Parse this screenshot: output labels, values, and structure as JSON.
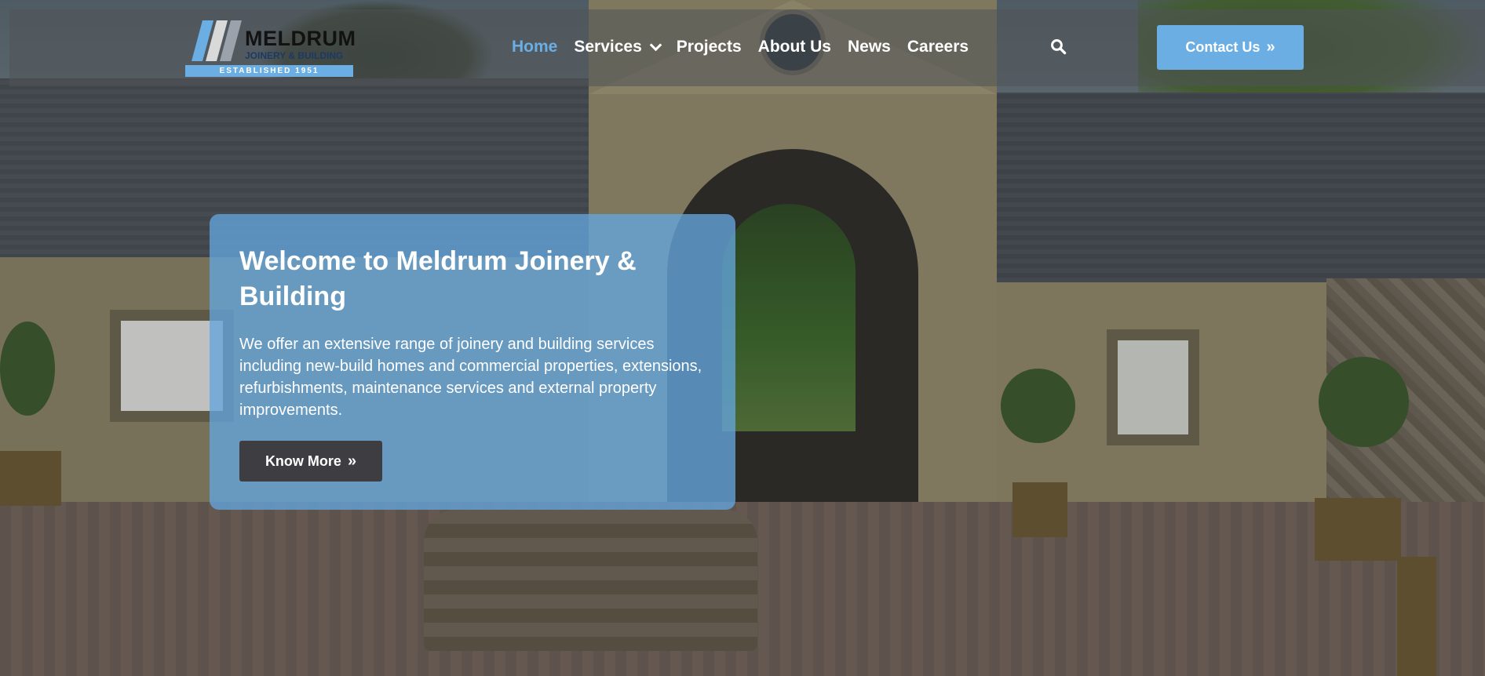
{
  "brand": {
    "name": "MELDRUM",
    "subtitle": "JOINERY & BUILDING",
    "established": "ESTABLISHED 1951",
    "accent": "#6aaee4"
  },
  "nav": {
    "items": [
      {
        "label": "Home",
        "active": true
      },
      {
        "label": "Services",
        "dropdown": true
      },
      {
        "label": "Projects"
      },
      {
        "label": "About Us"
      },
      {
        "label": "News"
      },
      {
        "label": "Careers"
      }
    ],
    "search_icon": "search-icon",
    "contact_label": "Contact Us",
    "contact_icon": "double-chevron-right-icon"
  },
  "hero": {
    "title": "Welcome to Meldrum Joinery & Building",
    "text": "We offer an extensive range of joinery and building services including new-build homes and commercial properties, extensions, refurbishments, maintenance services and external property improvements.",
    "button_label": "Know More",
    "button_icon": "double-chevron-right-icon"
  }
}
